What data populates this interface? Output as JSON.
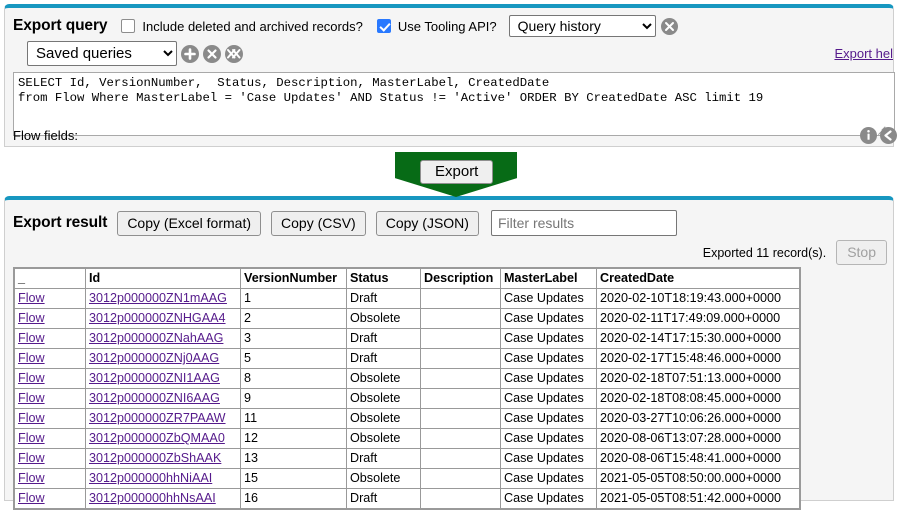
{
  "query_panel": {
    "title": "Export query",
    "include_deleted_label": "Include deleted and archived records?",
    "include_deleted_checked": false,
    "tooling_api_label": "Use Tooling API?",
    "tooling_api_checked": true,
    "history_select_value": "Query history",
    "history_clear_icon": "circle-x-icon",
    "saved_select_value": "Saved queries",
    "saved_add_icon": "circle-plus-icon",
    "saved_delete_icon": "circle-x-icon",
    "saved_delete_all_icon": "circle-double-x-icon",
    "export_help_link": "Export hel",
    "query_text": "SELECT Id, VersionNumber,  Status, Description, MasterLabel, CreatedDate\nfrom Flow Where MasterLabel = 'Case Updates' AND Status != 'Active' ORDER BY CreatedDate ASC limit 19",
    "flow_fields_label": "Flow fields:",
    "info_icon": "info-circle-icon",
    "second_icon": "circle-arrow-icon"
  },
  "export_button": {
    "label": "Export",
    "arrow_color": "#076b16"
  },
  "result_panel": {
    "title": "Export result",
    "copy_excel_label": "Copy (Excel format)",
    "copy_csv_label": "Copy (CSV)",
    "copy_json_label": "Copy (JSON)",
    "filter_placeholder": "Filter results",
    "filter_value": "",
    "exported_status": "Exported 11 record(s).",
    "stop_label": "Stop",
    "stop_disabled": true,
    "columns": [
      "_",
      "Id",
      "VersionNumber",
      "Status",
      "Description",
      "MasterLabel",
      "CreatedDate"
    ],
    "rows": [
      {
        "object": "Flow",
        "id": "3012p000000ZN1mAAG",
        "version": "1",
        "status": "Draft",
        "description": "",
        "master_label": "Case Updates",
        "created_date": "2020-02-10T18:19:43.000+0000"
      },
      {
        "object": "Flow",
        "id": "3012p000000ZNHGAA4",
        "version": "2",
        "status": "Obsolete",
        "description": "",
        "master_label": "Case Updates",
        "created_date": "2020-02-11T17:49:09.000+0000"
      },
      {
        "object": "Flow",
        "id": "3012p000000ZNahAAG",
        "version": "3",
        "status": "Draft",
        "description": "",
        "master_label": "Case Updates",
        "created_date": "2020-02-14T17:15:30.000+0000"
      },
      {
        "object": "Flow",
        "id": "3012p000000ZNj0AAG",
        "version": "5",
        "status": "Draft",
        "description": "",
        "master_label": "Case Updates",
        "created_date": "2020-02-17T15:48:46.000+0000"
      },
      {
        "object": "Flow",
        "id": "3012p000000ZNI1AAG",
        "version": "8",
        "status": "Obsolete",
        "description": "",
        "master_label": "Case Updates",
        "created_date": "2020-02-18T07:51:13.000+0000"
      },
      {
        "object": "Flow",
        "id": "3012p000000ZNI6AAG",
        "version": "9",
        "status": "Obsolete",
        "description": "",
        "master_label": "Case Updates",
        "created_date": "2020-02-18T08:08:45.000+0000"
      },
      {
        "object": "Flow",
        "id": "3012p000000ZR7PAAW",
        "version": "11",
        "status": "Obsolete",
        "description": "",
        "master_label": "Case Updates",
        "created_date": "2020-03-27T10:06:26.000+0000"
      },
      {
        "object": "Flow",
        "id": "3012p000000ZbQMAA0",
        "version": "12",
        "status": "Obsolete",
        "description": "",
        "master_label": "Case Updates",
        "created_date": "2020-08-06T13:07:28.000+0000"
      },
      {
        "object": "Flow",
        "id": "3012p000000ZbShAAK",
        "version": "13",
        "status": "Draft",
        "description": "",
        "master_label": "Case Updates",
        "created_date": "2020-08-06T15:48:41.000+0000"
      },
      {
        "object": "Flow",
        "id": "3012p000000hhNiAAI",
        "version": "15",
        "status": "Obsolete",
        "description": "",
        "master_label": "Case Updates",
        "created_date": "2021-05-05T08:50:00.000+0000"
      },
      {
        "object": "Flow",
        "id": "3012p000000hhNsAAI",
        "version": "16",
        "status": "Draft",
        "description": "",
        "master_label": "Case Updates",
        "created_date": "2021-05-05T08:51:42.000+0000"
      }
    ]
  },
  "theme": {
    "accent": "#1797c0",
    "link": "#551a8b",
    "checkbox_checked": "#2979ff",
    "green": "#076b16"
  }
}
